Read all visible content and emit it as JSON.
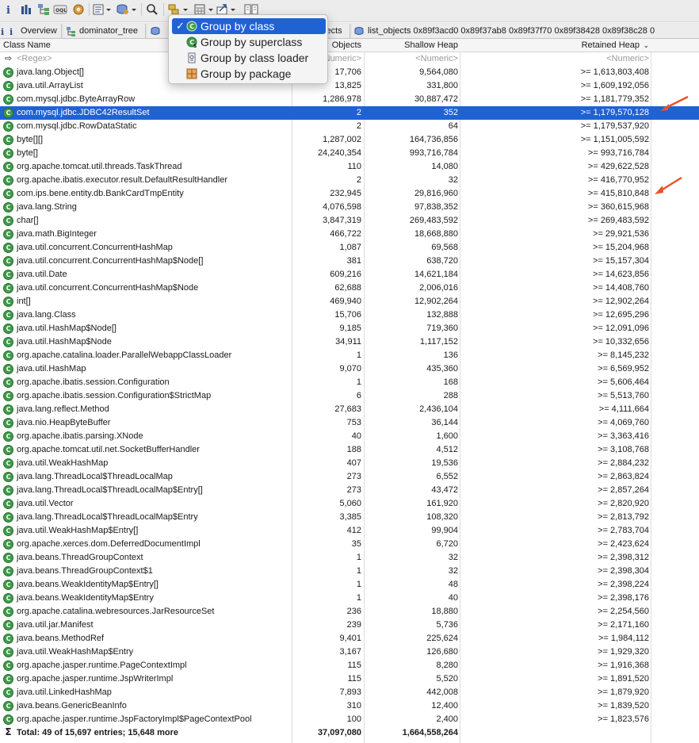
{
  "toolbar": {
    "icons": [
      "info-icon",
      "histogram-icon",
      "dominator-tree-icon",
      "oql-icon",
      "settings-icon",
      "report-icon",
      "query-icon",
      "search-icon",
      "group-by-icon",
      "calculator-icon",
      "export-icon",
      "compare-icon"
    ]
  },
  "tabs": [
    {
      "label": "Overview"
    },
    {
      "label": "dominator_tree"
    },
    {
      "label": "bjects"
    },
    {
      "label": "list_objects 0x89f3acd0 0x89f37ab8 0x89f37f70 0x89f38428 0x89f38c28 0"
    }
  ],
  "menu": {
    "items": [
      {
        "label": "Group by class",
        "checked": true,
        "icon": "class-icon"
      },
      {
        "label": "Group by superclass",
        "checked": false,
        "icon": "superclass-icon"
      },
      {
        "label": "Group by class loader",
        "checked": false,
        "icon": "class-loader-icon"
      },
      {
        "label": "Group by package",
        "checked": false,
        "icon": "package-icon"
      }
    ]
  },
  "table": {
    "headers": {
      "class_name": "Class Name",
      "objects": "Objects",
      "shallow_heap": "Shallow Heap",
      "retained_heap": "Retained Heap"
    },
    "filter": {
      "class_name": "<Regex>",
      "objects": "Numeric>",
      "shallow_heap": "<Numeric>",
      "retained_heap": "<Numeric>"
    },
    "rows": [
      {
        "name": "java.lang.Object[]",
        "objects": "17,706",
        "shallow": "9,564,080",
        "retained": ">= 1,613,803,408"
      },
      {
        "name": "java.util.ArrayList",
        "objects": "13,825",
        "shallow": "331,800",
        "retained": ">= 1,609,192,056"
      },
      {
        "name": "com.mysql.jdbc.ByteArrayRow",
        "objects": "1,286,978",
        "shallow": "30,887,472",
        "retained": ">= 1,181,779,352"
      },
      {
        "name": "com.mysql.jdbc.JDBC42ResultSet",
        "objects": "2",
        "shallow": "352",
        "retained": ">= 1,179,570,128",
        "selected": true
      },
      {
        "name": "com.mysql.jdbc.RowDataStatic",
        "objects": "2",
        "shallow": "64",
        "retained": ">= 1,179,537,920"
      },
      {
        "name": "byte[][]",
        "objects": "1,287,002",
        "shallow": "164,736,856",
        "retained": ">= 1,151,005,592"
      },
      {
        "name": "byte[]",
        "objects": "24,240,354",
        "shallow": "993,716,784",
        "retained": ">= 993,716,784"
      },
      {
        "name": "org.apache.tomcat.util.threads.TaskThread",
        "objects": "110",
        "shallow": "14,080",
        "retained": ">= 429,622,528"
      },
      {
        "name": "org.apache.ibatis.executor.result.DefaultResultHandler",
        "objects": "2",
        "shallow": "32",
        "retained": ">= 416,770,952"
      },
      {
        "name": "com.ips.bene.entity.db.BankCardTmpEntity",
        "objects": "232,945",
        "shallow": "29,816,960",
        "retained": ">= 415,810,848"
      },
      {
        "name": "java.lang.String",
        "objects": "4,076,598",
        "shallow": "97,838,352",
        "retained": ">= 360,615,968"
      },
      {
        "name": "char[]",
        "objects": "3,847,319",
        "shallow": "269,483,592",
        "retained": ">= 269,483,592"
      },
      {
        "name": "java.math.BigInteger",
        "objects": "466,722",
        "shallow": "18,668,880",
        "retained": ">= 29,921,536"
      },
      {
        "name": "java.util.concurrent.ConcurrentHashMap",
        "objects": "1,087",
        "shallow": "69,568",
        "retained": ">= 15,204,968"
      },
      {
        "name": "java.util.concurrent.ConcurrentHashMap$Node[]",
        "objects": "381",
        "shallow": "638,720",
        "retained": ">= 15,157,304"
      },
      {
        "name": "java.util.Date",
        "objects": "609,216",
        "shallow": "14,621,184",
        "retained": ">= 14,623,856"
      },
      {
        "name": "java.util.concurrent.ConcurrentHashMap$Node",
        "objects": "62,688",
        "shallow": "2,006,016",
        "retained": ">= 14,408,760"
      },
      {
        "name": "int[]",
        "objects": "469,940",
        "shallow": "12,902,264",
        "retained": ">= 12,902,264"
      },
      {
        "name": "java.lang.Class",
        "objects": "15,706",
        "shallow": "132,888",
        "retained": ">= 12,695,296"
      },
      {
        "name": "java.util.HashMap$Node[]",
        "objects": "9,185",
        "shallow": "719,360",
        "retained": ">= 12,091,096"
      },
      {
        "name": "java.util.HashMap$Node",
        "objects": "34,911",
        "shallow": "1,117,152",
        "retained": ">= 10,332,656"
      },
      {
        "name": "org.apache.catalina.loader.ParallelWebappClassLoader",
        "objects": "1",
        "shallow": "136",
        "retained": ">= 8,145,232"
      },
      {
        "name": "java.util.HashMap",
        "objects": "9,070",
        "shallow": "435,360",
        "retained": ">= 6,569,952"
      },
      {
        "name": "org.apache.ibatis.session.Configuration",
        "objects": "1",
        "shallow": "168",
        "retained": ">= 5,606,464"
      },
      {
        "name": "org.apache.ibatis.session.Configuration$StrictMap",
        "objects": "6",
        "shallow": "288",
        "retained": ">= 5,513,760"
      },
      {
        "name": "java.lang.reflect.Method",
        "objects": "27,683",
        "shallow": "2,436,104",
        "retained": ">= 4,111,664"
      },
      {
        "name": "java.nio.HeapByteBuffer",
        "objects": "753",
        "shallow": "36,144",
        "retained": ">= 4,069,760"
      },
      {
        "name": "org.apache.ibatis.parsing.XNode",
        "objects": "40",
        "shallow": "1,600",
        "retained": ">= 3,363,416"
      },
      {
        "name": "org.apache.tomcat.util.net.SocketBufferHandler",
        "objects": "188",
        "shallow": "4,512",
        "retained": ">= 3,108,768"
      },
      {
        "name": "java.util.WeakHashMap",
        "objects": "407",
        "shallow": "19,536",
        "retained": ">= 2,884,232"
      },
      {
        "name": "java.lang.ThreadLocal$ThreadLocalMap",
        "objects": "273",
        "shallow": "6,552",
        "retained": ">= 2,863,824"
      },
      {
        "name": "java.lang.ThreadLocal$ThreadLocalMap$Entry[]",
        "objects": "273",
        "shallow": "43,472",
        "retained": ">= 2,857,264"
      },
      {
        "name": "java.util.Vector",
        "objects": "5,060",
        "shallow": "161,920",
        "retained": ">= 2,820,920"
      },
      {
        "name": "java.lang.ThreadLocal$ThreadLocalMap$Entry",
        "objects": "3,385",
        "shallow": "108,320",
        "retained": ">= 2,813,792"
      },
      {
        "name": "java.util.WeakHashMap$Entry[]",
        "objects": "412",
        "shallow": "99,904",
        "retained": ">= 2,783,704"
      },
      {
        "name": "org.apache.xerces.dom.DeferredDocumentImpl",
        "objects": "35",
        "shallow": "6,720",
        "retained": ">= 2,423,624"
      },
      {
        "name": "java.beans.ThreadGroupContext",
        "objects": "1",
        "shallow": "32",
        "retained": ">= 2,398,312"
      },
      {
        "name": "java.beans.ThreadGroupContext$1",
        "objects": "1",
        "shallow": "32",
        "retained": ">= 2,398,304"
      },
      {
        "name": "java.beans.WeakIdentityMap$Entry[]",
        "objects": "1",
        "shallow": "48",
        "retained": ">= 2,398,224"
      },
      {
        "name": "java.beans.WeakIdentityMap$Entry",
        "objects": "1",
        "shallow": "40",
        "retained": ">= 2,398,176"
      },
      {
        "name": "org.apache.catalina.webresources.JarResourceSet",
        "objects": "236",
        "shallow": "18,880",
        "retained": ">= 2,254,560"
      },
      {
        "name": "java.util.jar.Manifest",
        "objects": "239",
        "shallow": "5,736",
        "retained": ">= 2,171,160"
      },
      {
        "name": "java.beans.MethodRef",
        "objects": "9,401",
        "shallow": "225,624",
        "retained": ">= 1,984,112"
      },
      {
        "name": "java.util.WeakHashMap$Entry",
        "objects": "3,167",
        "shallow": "126,680",
        "retained": ">= 1,929,320"
      },
      {
        "name": "org.apache.jasper.runtime.PageContextImpl",
        "objects": "115",
        "shallow": "8,280",
        "retained": ">= 1,916,368"
      },
      {
        "name": "org.apache.jasper.runtime.JspWriterImpl",
        "objects": "115",
        "shallow": "5,520",
        "retained": ">= 1,891,520"
      },
      {
        "name": "java.util.LinkedHashMap",
        "objects": "7,893",
        "shallow": "442,008",
        "retained": ">= 1,879,920"
      },
      {
        "name": "java.beans.GenericBeanInfo",
        "objects": "310",
        "shallow": "12,400",
        "retained": ">= 1,839,520"
      },
      {
        "name": "org.apache.jasper.runtime.JspFactoryImpl$PageContextPool",
        "objects": "100",
        "shallow": "2,400",
        "retained": ">= 1,823,576"
      }
    ],
    "total": {
      "label": "Total: 49 of 15,697 entries; 15,648 more",
      "objects": "37,097,080",
      "shallow": "1,664,558,264",
      "retained": ""
    }
  },
  "colors": {
    "selection": "#1f62d4",
    "class_icon": "#3f9a4a",
    "annotation_arrow": "#e8542a"
  }
}
